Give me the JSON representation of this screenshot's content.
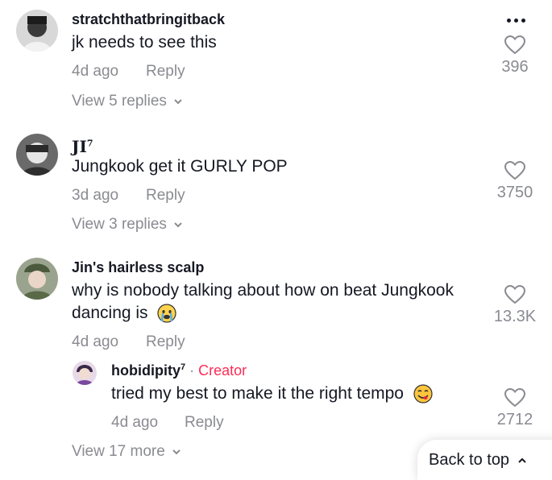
{
  "comments": [
    {
      "username": "stratchthatbringitback",
      "text": "jk needs to see this",
      "time": "4d ago",
      "reply_label": "Reply",
      "likes": "396",
      "view_replies": "View 5 replies",
      "more_icon": "ellipsis-icon"
    },
    {
      "username": "JI",
      "username_sup": "7",
      "text": "Jungkook get it GURLY POP",
      "time": "3d ago",
      "reply_label": "Reply",
      "likes": "3750",
      "view_replies": "View 3 replies"
    },
    {
      "username": "Jin's hairless scalp",
      "text_line1": "why is nobody talking about how on beat Jungkook",
      "text_line2": "dancing is",
      "emoji": "crying-face-emoji",
      "time": "4d ago",
      "reply_label": "Reply",
      "likes": "13.3K",
      "reply": {
        "username": "hobidipity",
        "username_sup": "7",
        "separator": "·",
        "badge": "Creator",
        "text": "tried my best to make it the right tempo",
        "emoji": "yum-face-emoji",
        "time": "4d ago",
        "reply_label": "Reply",
        "likes": "2712"
      },
      "view_more": "View 17 more"
    }
  ],
  "back_to_top": "Back to top",
  "colors": {
    "text": "#161823",
    "muted": "#8a8b91",
    "creator": "#fe2c55"
  }
}
